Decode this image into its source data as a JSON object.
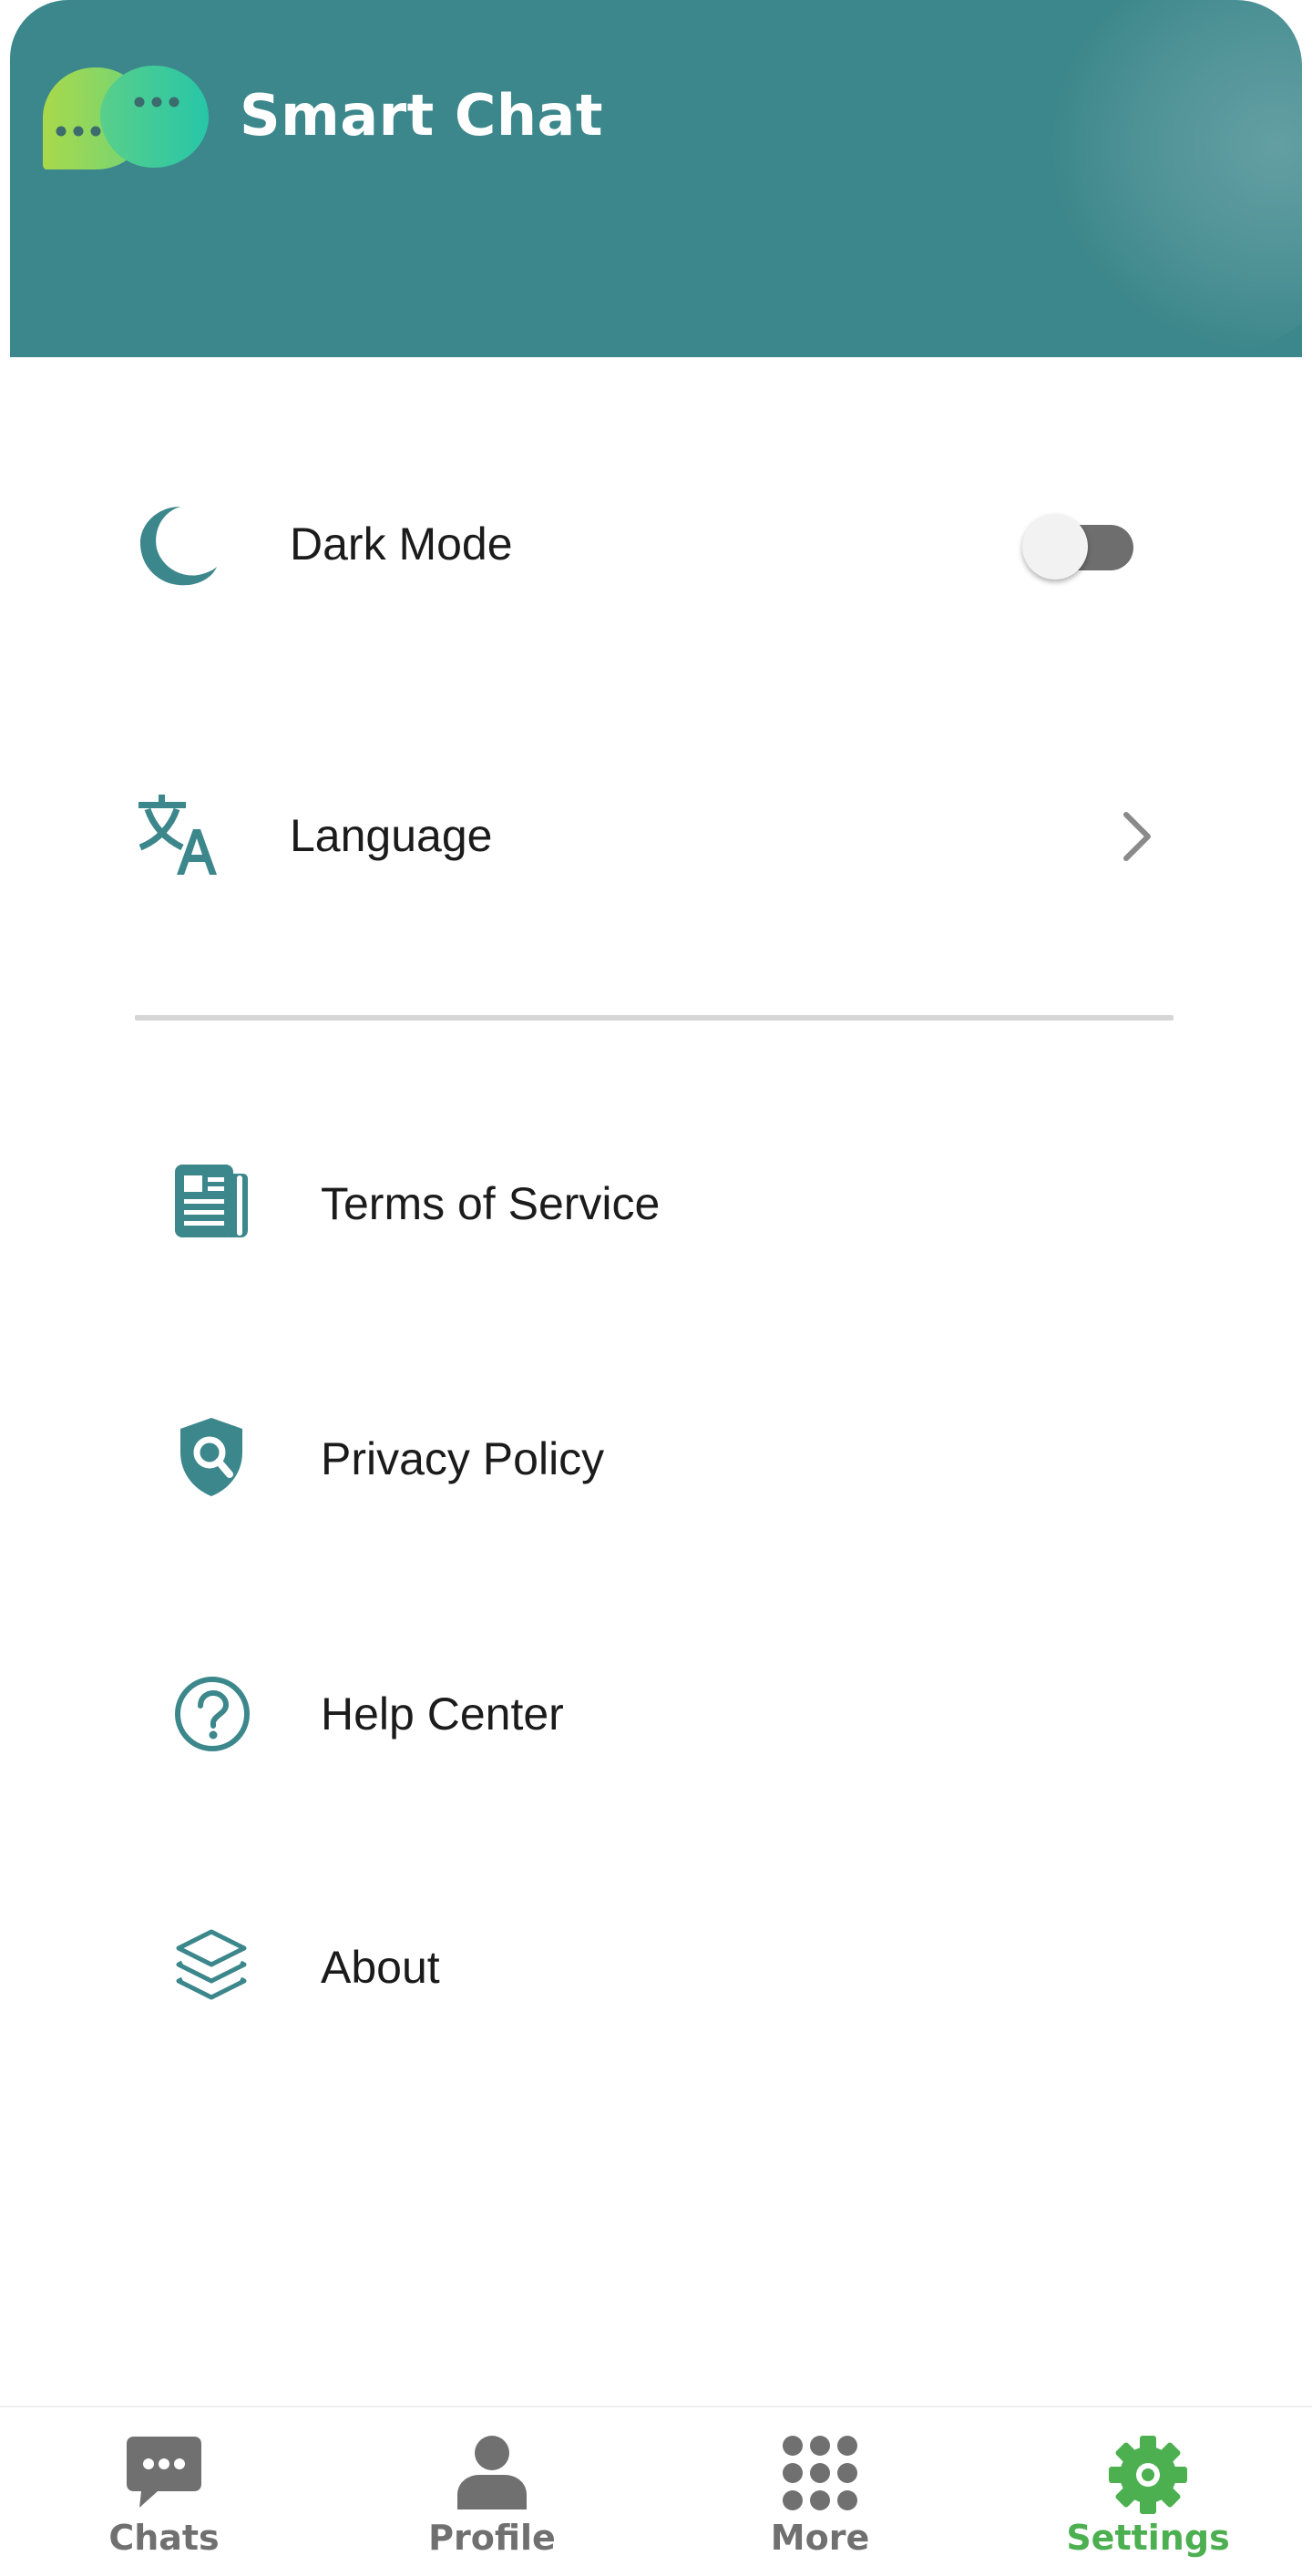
{
  "app": {
    "title": "Smart Chat"
  },
  "colors": {
    "header": "#3c878b",
    "icon_teal": "#3c878b",
    "active_nav": "#4caf50",
    "inactive_nav": "#707070",
    "logo_gradient": [
      "#a6d94b",
      "#2ec7a0"
    ]
  },
  "settings": {
    "dark_mode": {
      "label": "Dark Mode",
      "icon": "moon-icon",
      "enabled": false
    },
    "language": {
      "label": "Language",
      "icon": "translate-icon",
      "chevron_icon": "chevron-right-icon"
    }
  },
  "links": [
    {
      "label": "Terms of Service",
      "icon": "document-icon"
    },
    {
      "label": "Privacy Policy",
      "icon": "shield-search-icon"
    },
    {
      "label": "Help Center",
      "icon": "help-circle-icon"
    },
    {
      "label": "About",
      "icon": "layers-icon"
    }
  ],
  "bottom_nav": {
    "active": "Settings",
    "items": [
      {
        "label": "Chats",
        "icon": "chat-bubble-icon"
      },
      {
        "label": "Profile",
        "icon": "person-icon"
      },
      {
        "label": "More",
        "icon": "grid-dots-icon"
      },
      {
        "label": "Settings",
        "icon": "gear-icon"
      }
    ]
  }
}
